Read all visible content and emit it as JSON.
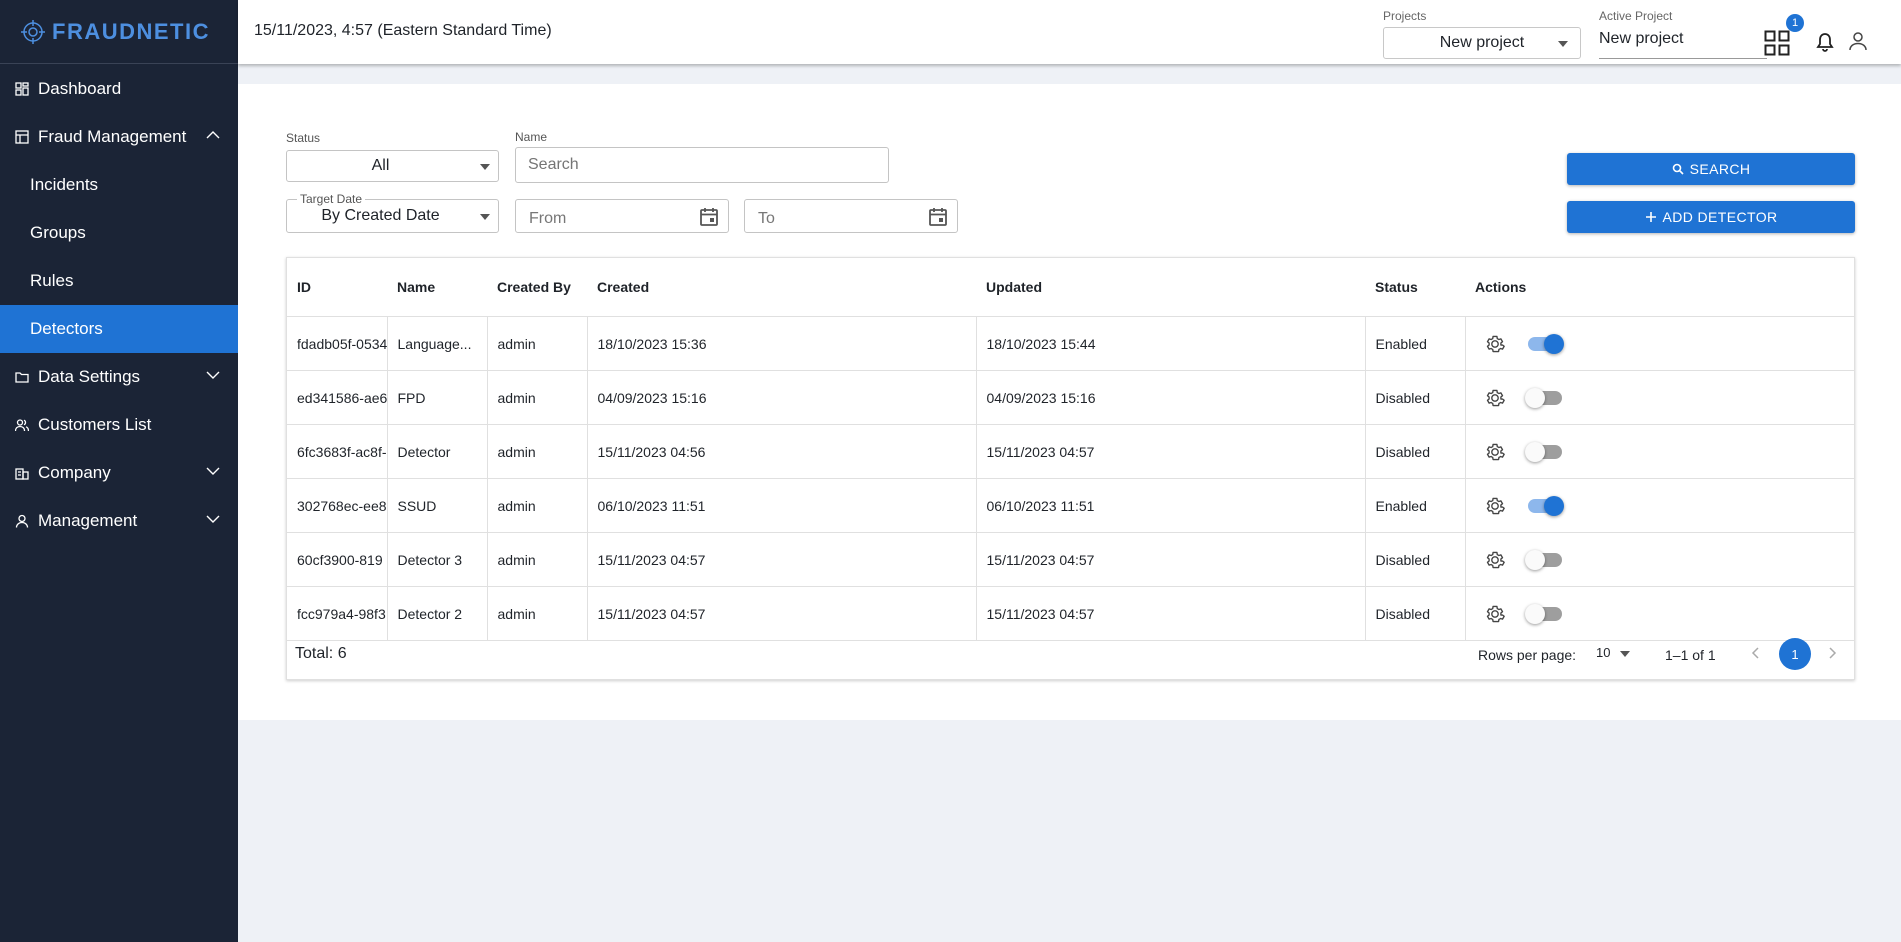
{
  "sidebar": {
    "logo": "FRAUDNETIC",
    "items": [
      {
        "label": "Dashboard"
      },
      {
        "label": "Fraud Management"
      },
      {
        "label": "Incidents"
      },
      {
        "label": "Groups"
      },
      {
        "label": "Rules"
      },
      {
        "label": "Detectors"
      },
      {
        "label": "Data Settings"
      },
      {
        "label": "Customers List"
      },
      {
        "label": "Company"
      },
      {
        "label": "Management"
      }
    ]
  },
  "header": {
    "datetime": "15/11/2023, 4:57 (Eastern Standard Time)",
    "projects_label": "Projects",
    "projects_value": "New project",
    "active_label": "Active Project",
    "active_value": "New project",
    "notification_count": "1"
  },
  "filters": {
    "status_label": "Status",
    "status_value": "All",
    "name_label": "Name",
    "name_placeholder": "Search",
    "target_label": "Target Date",
    "target_value": "By Created Date",
    "from_placeholder": "From",
    "to_placeholder": "To",
    "search_button": "SEARCH",
    "add_button": "ADD DETECTOR"
  },
  "table": {
    "columns": [
      "ID",
      "Name",
      "Created By",
      "Created",
      "Updated",
      "Status",
      "Actions"
    ],
    "rows": [
      {
        "id": "fdadb05f-0534",
        "name": "Language...",
        "created_by": "admin",
        "created": "18/10/2023 15:36",
        "updated": "18/10/2023 15:44",
        "status": "Enabled",
        "enabled": true
      },
      {
        "id": "ed341586-ae6",
        "name": "FPD",
        "created_by": "admin",
        "created": "04/09/2023 15:16",
        "updated": "04/09/2023 15:16",
        "status": "Disabled",
        "enabled": false
      },
      {
        "id": "6fc3683f-ac8f-",
        "name": "Detector",
        "created_by": "admin",
        "created": "15/11/2023 04:56",
        "updated": "15/11/2023 04:57",
        "status": "Disabled",
        "enabled": false
      },
      {
        "id": "302768ec-ee8",
        "name": "SSUD",
        "created_by": "admin",
        "created": "06/10/2023 11:51",
        "updated": "06/10/2023 11:51",
        "status": "Enabled",
        "enabled": true
      },
      {
        "id": "60cf3900-819",
        "name": "Detector 3",
        "created_by": "admin",
        "created": "15/11/2023 04:57",
        "updated": "15/11/2023 04:57",
        "status": "Disabled",
        "enabled": false
      },
      {
        "id": "fcc979a4-98f3",
        "name": "Detector 2",
        "created_by": "admin",
        "created": "15/11/2023 04:57",
        "updated": "15/11/2023 04:57",
        "status": "Disabled",
        "enabled": false
      }
    ],
    "total": "Total: 6",
    "rows_per_page_label": "Rows per page:",
    "rows_per_page_value": "10",
    "range": "1–1 of 1",
    "current_page": "1"
  },
  "colors": {
    "sidebar_bg": "#1b2436",
    "accent": "#1f73d4"
  }
}
